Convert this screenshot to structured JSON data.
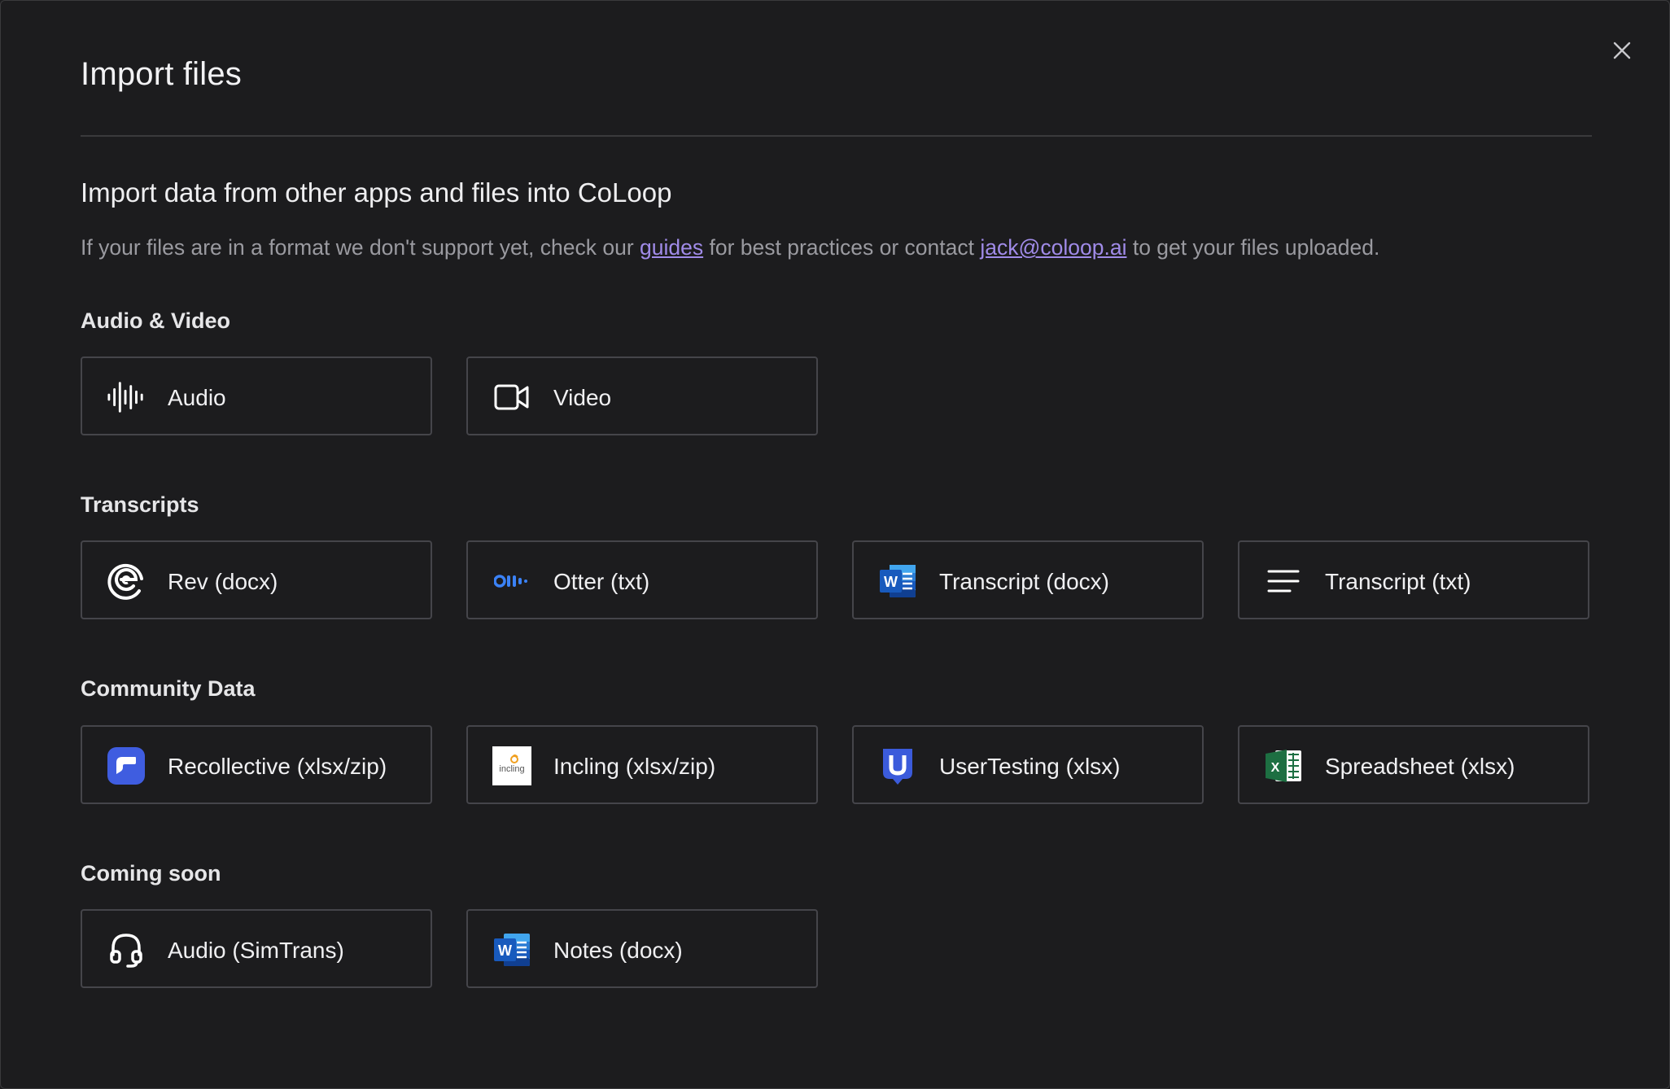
{
  "modal": {
    "title": "Import files",
    "close_icon": "close-icon",
    "subtitle": "Import data from other apps and files into CoLoop",
    "description": {
      "before_guides": "If your files are in a format we don't support yet, check our ",
      "guides_link": "guides",
      "between": " for best practices or contact ",
      "email_link": "jack@coloop.ai",
      "after": " to get your files uploaded."
    }
  },
  "sections": {
    "audio_video": {
      "label": "Audio & Video",
      "items": [
        {
          "label": "Audio",
          "icon": "audio-waveform-icon"
        },
        {
          "label": "Video",
          "icon": "video-camera-icon"
        }
      ]
    },
    "transcripts": {
      "label": "Transcripts",
      "items": [
        {
          "label": "Rev (docx)",
          "icon": "rev-logo-icon"
        },
        {
          "label": "Otter (txt)",
          "icon": "otter-logo-icon"
        },
        {
          "label": "Transcript (docx)",
          "icon": "word-doc-icon"
        },
        {
          "label": "Transcript (txt)",
          "icon": "text-lines-icon"
        }
      ]
    },
    "community_data": {
      "label": "Community Data",
      "items": [
        {
          "label": "Recollective (xlsx/zip)",
          "icon": "recollective-logo-icon"
        },
        {
          "label": "Incling (xlsx/zip)",
          "icon": "incling-logo-icon",
          "logo_text": "incling"
        },
        {
          "label": "UserTesting (xlsx)",
          "icon": "usertesting-logo-icon"
        },
        {
          "label": "Spreadsheet (xlsx)",
          "icon": "excel-sheet-icon"
        }
      ]
    },
    "coming_soon": {
      "label": "Coming soon",
      "items": [
        {
          "label": "Audio (SimTrans)",
          "icon": "headset-icon"
        },
        {
          "label": "Notes (docx)",
          "icon": "word-doc-icon"
        }
      ]
    }
  },
  "colors": {
    "background": "#1c1c1e",
    "card_border": "#45454a",
    "link": "#a08be8",
    "word_blue": "#2b579a",
    "excel_green": "#1d6f42",
    "otter_blue": "#3b82f6",
    "recollective_blue": "#3f5de0",
    "usertesting_blue": "#3b5bdb"
  }
}
